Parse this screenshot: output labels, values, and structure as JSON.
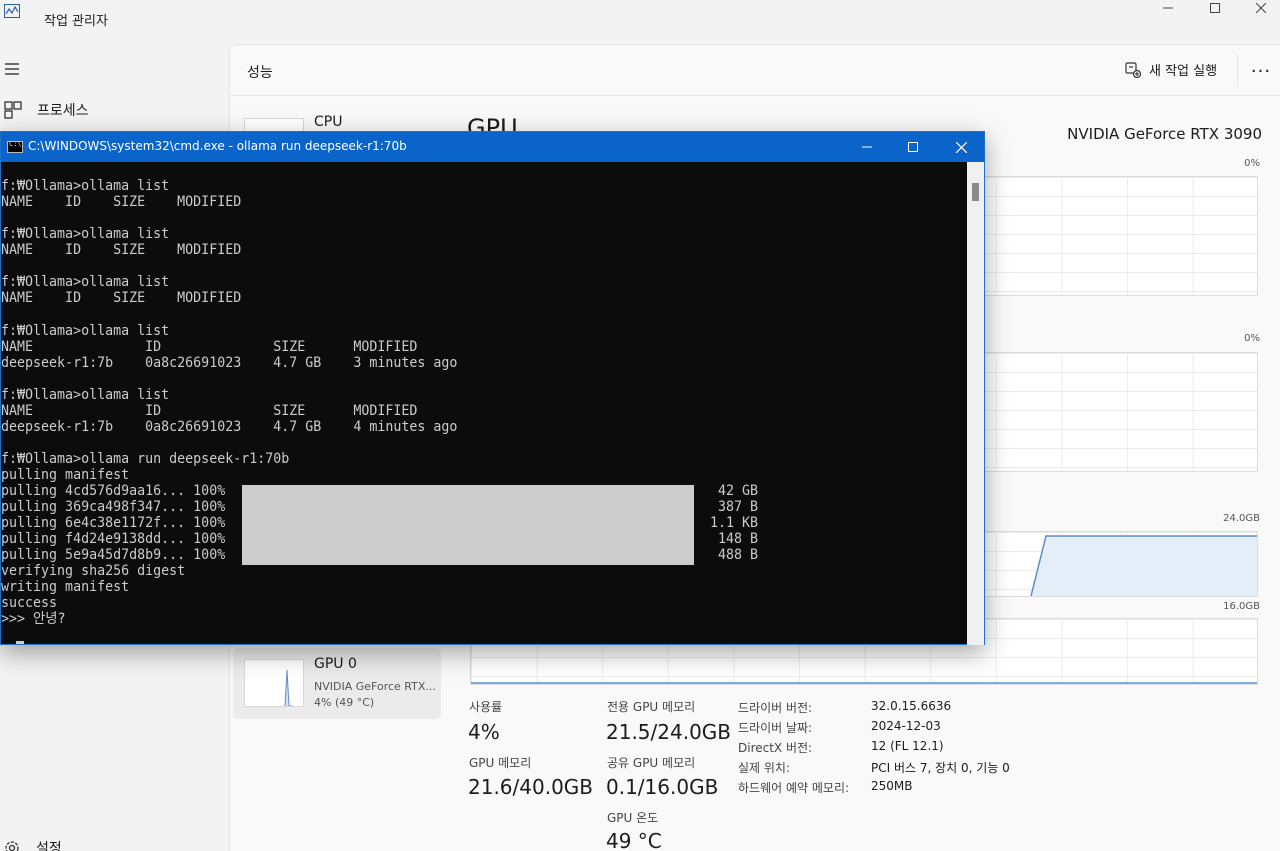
{
  "taskmgr": {
    "title": "작업 관리자",
    "nav": {
      "processes": "프로세스",
      "settings": "설정"
    },
    "header": {
      "page_title": "성능",
      "run_task": "새 작업 실행",
      "more": "..."
    },
    "cards": {
      "cpu": {
        "name": "CPU"
      },
      "gpu0": {
        "name": "GPU 0",
        "model": "NVIDIA GeForce RTX...",
        "usage": "4% (49 °C)"
      }
    },
    "gpu": {
      "title": "GPU",
      "model": "NVIDIA GeForce RTX 3090",
      "charts": {
        "pct_top": "0%",
        "pct_mid": "0%",
        "dedicated_max": "24.0GB",
        "shared_max": "16.0GB"
      },
      "stats": {
        "usage_label": "사용률",
        "usage_value": "4%",
        "gpu_mem_label": "GPU 메모리",
        "gpu_mem_value": "21.6/40.0GB",
        "dedicated_label": "전용 GPU 메모리",
        "dedicated_value": "21.5/24.0GB",
        "shared_label": "공유 GPU 메모리",
        "shared_value": "0.1/16.0GB",
        "temp_label": "GPU 온도",
        "temp_value": "49 °C"
      },
      "info": [
        {
          "label": "드라이버 버전:",
          "value": "32.0.15.6636"
        },
        {
          "label": "드라이버 날짜:",
          "value": "2024-12-03"
        },
        {
          "label": "DirectX 버전:",
          "value": "12 (FL 12.1)"
        },
        {
          "label": "실제 위치:",
          "value": "PCI 버스 7, 장치 0, 기능 0"
        },
        {
          "label": "하드웨어 예약 메모리:",
          "value": "250MB"
        }
      ]
    }
  },
  "cmd": {
    "title": "C:\\WINDOWS\\system32\\cmd.exe - ollama  run deepseek-r1:70b",
    "icon_text": "C:\\",
    "lines": [
      "f:₩Ollama>ollama list",
      "NAME    ID    SIZE    MODIFIED",
      "",
      "f:₩Ollama>ollama list",
      "NAME    ID    SIZE    MODIFIED",
      "",
      "f:₩Ollama>ollama list",
      "NAME    ID    SIZE    MODIFIED",
      "",
      "f:₩Ollama>ollama list",
      "NAME              ID              SIZE      MODIFIED",
      "deepseek-r1:7b    0a8c26691023    4.7 GB    3 minutes ago",
      "",
      "f:₩Ollama>ollama list",
      "NAME              ID              SIZE      MODIFIED",
      "deepseek-r1:7b    0a8c26691023    4.7 GB    4 minutes ago",
      "",
      "f:₩Ollama>ollama run deepseek-r1:70b",
      "pulling manifest"
    ],
    "pulls": [
      {
        "text": "pulling 4cd576d9aa16... 100%",
        "size": " 42 GB"
      },
      {
        "text": "pulling 369ca498f347... 100%",
        "size": "387 B"
      },
      {
        "text": "pulling 6e4c38e1172f... 100%",
        "size": "1.1 KB"
      },
      {
        "text": "pulling f4d24e9138dd... 100%",
        "size": "148 B"
      },
      {
        "text": "pulling 5e9a45d7d8b9... 100%",
        "size": "488 B"
      }
    ],
    "tail": [
      "verifying sha256 digest",
      "writing manifest",
      "success",
      ">>> 안녕?"
    ]
  }
}
